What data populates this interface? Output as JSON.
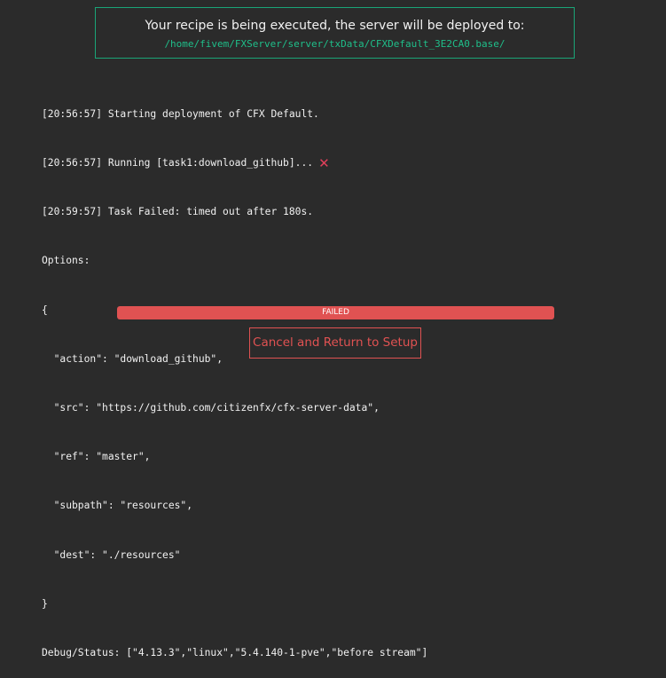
{
  "deploy": {
    "title": "Your recipe is being executed, the server will be deployed to:",
    "path": "/home/fivem/FXServer/server/txData/CFXDefault_3E2CA0.base/"
  },
  "log": {
    "lines": [
      "[20:56:57] Starting deployment of CFX Default.",
      "[20:56:57] Running [task1:download_github]...",
      "[20:59:57] Task Failed: timed out after 180s.",
      "Options:",
      "{",
      "  \"action\": \"download_github\",",
      "  \"src\": \"https://github.com/citizenfx/cfx-server-data\",",
      "  \"ref\": \"master\",",
      "  \"subpath\": \"resources\",",
      "  \"dest\": \"./resources\"",
      "}",
      "Debug/Status: [\"4.13.3\",\"linux\",\"5.4.140-1-pve\",\"before stream\"]"
    ],
    "fail_icon": "close-icon",
    "fail_color": "#e0405a"
  },
  "progress": {
    "label": "FAILED",
    "percent": 100,
    "color": "#e05252"
  },
  "cancel_button": {
    "label": "Cancel and Return to Setup",
    "color": "#e05252"
  },
  "colors": {
    "background": "#2b2b2b",
    "accent": "#1aa577"
  }
}
